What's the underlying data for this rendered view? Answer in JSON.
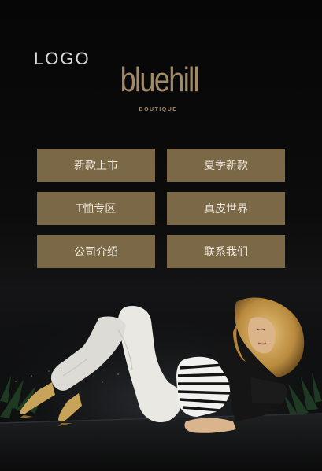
{
  "header": {
    "logo_placeholder": "LOGO",
    "brand_name": "bluehill",
    "brand_sub": "BOUTIQUE"
  },
  "menu": {
    "items": [
      {
        "label": "新款上市"
      },
      {
        "label": "夏季新款"
      },
      {
        "label": "T恤专区"
      },
      {
        "label": "真皮世界"
      },
      {
        "label": "公司介绍"
      },
      {
        "label": "联系我们"
      }
    ]
  },
  "colors": {
    "background": "#0a0a0a",
    "button_bg": "#7b6846",
    "button_text": "#f2ece0",
    "brand": "#a08a6a"
  }
}
